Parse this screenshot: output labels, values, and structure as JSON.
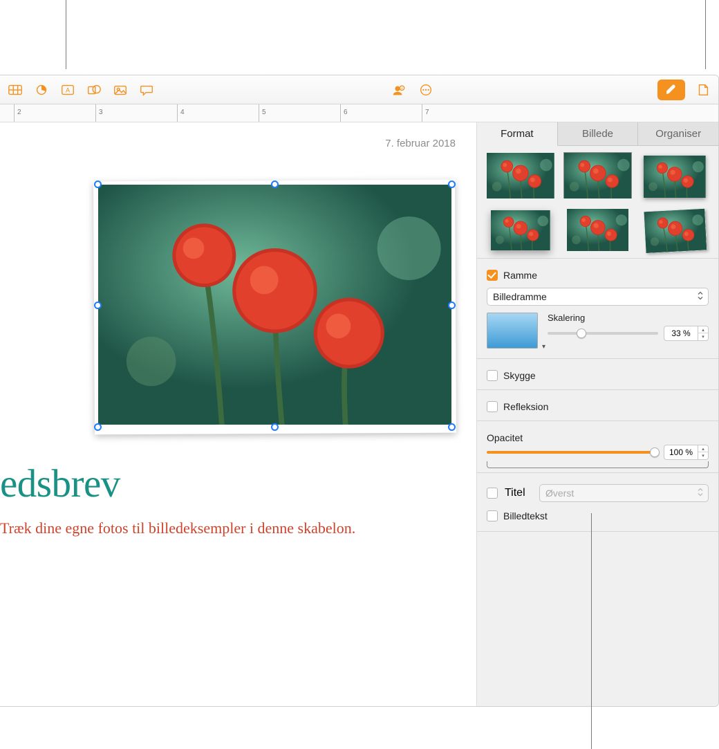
{
  "toolbar": {
    "table_icon": "table-icon",
    "chart_icon": "pie-chart-icon",
    "text_icon": "text-box-icon",
    "shape_icon": "shape-icon",
    "media_icon": "media-icon",
    "comment_icon": "comment-icon",
    "collab_icon": "collaborate-icon",
    "more_icon": "more-icon",
    "format_icon": "paintbrush-icon",
    "document_icon": "document-icon"
  },
  "ruler": {
    "marks": [
      "2",
      "3",
      "4",
      "5",
      "6",
      "7"
    ]
  },
  "doc": {
    "date": "7. februar 2018",
    "headline": "edsbrev",
    "subtext": "Træk dine egne fotos til billedeksempler i denne skabelon."
  },
  "sidebar": {
    "tabs": {
      "format": "Format",
      "image": "Billede",
      "organize": "Organiser"
    },
    "frame": {
      "checkbox_label": "Ramme",
      "dropdown": "Billedramme",
      "scale_label": "Skalering",
      "scale_value": "33 %"
    },
    "shadow": {
      "label": "Skygge"
    },
    "reflection": {
      "label": "Refleksion"
    },
    "opacity": {
      "label": "Opacitet",
      "value": "100 %"
    },
    "title": {
      "label": "Titel",
      "position": "Øverst"
    },
    "caption": {
      "label": "Billedtekst"
    }
  }
}
